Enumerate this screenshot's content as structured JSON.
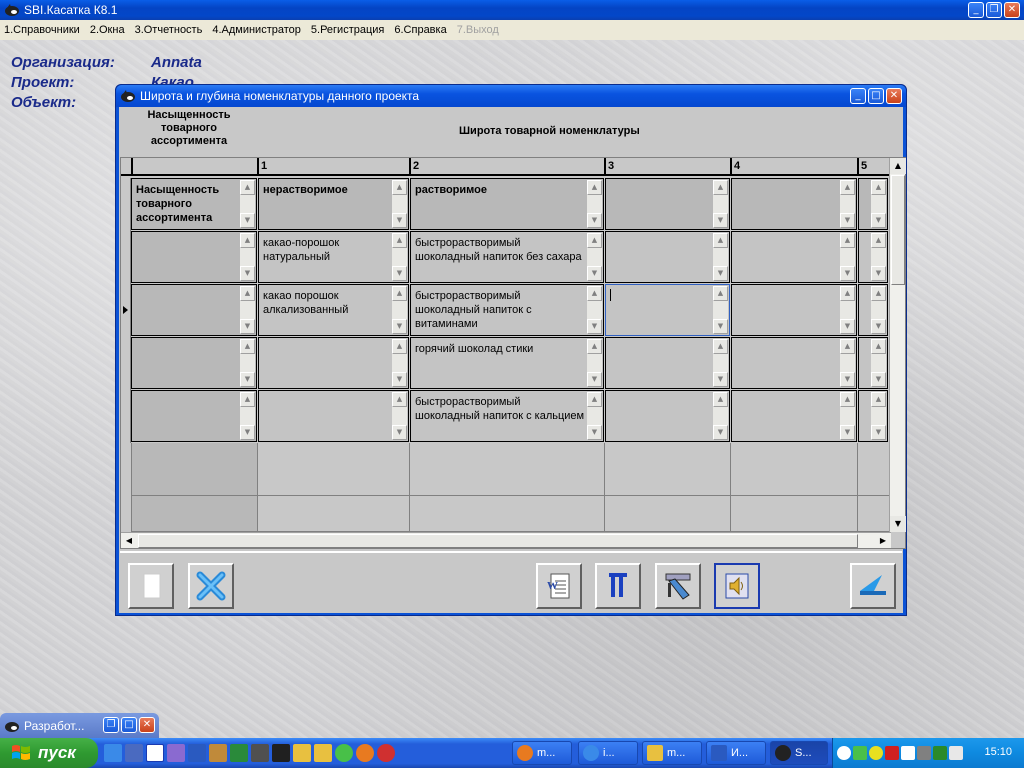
{
  "app": {
    "title": "SBI.Касатка К8.1",
    "menu": [
      {
        "label": "1.Справочники",
        "enabled": true
      },
      {
        "label": "2.Окна",
        "enabled": true
      },
      {
        "label": "3.Отчетность",
        "enabled": true
      },
      {
        "label": "4.Администратор",
        "enabled": true
      },
      {
        "label": "5.Регистрация",
        "enabled": true
      },
      {
        "label": "6.Справка",
        "enabled": true
      },
      {
        "label": "7.Выход",
        "enabled": false
      }
    ]
  },
  "info": {
    "org_label": "Организация:",
    "org_value": "Annata",
    "project_label": "Проект:",
    "project_value": "Какао",
    "object_label": "Объект:"
  },
  "dialog": {
    "title": "Широта и глубина номенклатуры данного проекта",
    "header_left": "Насыщенность товарного ассортимента",
    "header_right": "Широта товарной номенклатуры",
    "column_numbers": [
      "1",
      "2",
      "3",
      "4",
      "5"
    ],
    "rows": [
      {
        "first": "Насыщенность товарного ассортимента",
        "cells": [
          "нерастворимое",
          "растворимое",
          "",
          ""
        ],
        "is_header": true,
        "current": false
      },
      {
        "first": "",
        "cells": [
          "какао-порошок натуральный",
          "быстрорастворимый шоколадный напиток без сахара",
          "",
          ""
        ],
        "is_header": false,
        "current": false
      },
      {
        "first": "",
        "cells": [
          "какао порошок алкализованный",
          "быстрорастворимый шоколадный напиток с витаминами",
          "",
          ""
        ],
        "is_header": false,
        "current": true
      },
      {
        "first": "",
        "cells": [
          "",
          "горячий шоколад стики",
          "",
          ""
        ],
        "is_header": false,
        "current": false
      },
      {
        "first": "",
        "cells": [
          "",
          "быстрорастворимый шоколадный напиток с кальцием",
          "",
          ""
        ],
        "is_header": false,
        "current": false
      }
    ],
    "toolbar": {
      "left_buttons": [
        "new-document-icon",
        "delete-x-icon"
      ],
      "right_buttons": [
        "word-export-icon",
        "paragraph-icon",
        "film-icon",
        "speaker-icon"
      ],
      "exit_button": "back-arrow-icon"
    }
  },
  "minimized_window": {
    "title": "Разработ..."
  },
  "taskbar": {
    "start_label": "пуск",
    "quick_launch": [
      "ie-icon",
      "user-icon",
      "info-icon",
      "spider-icon",
      "word-icon",
      "db-icon",
      "excel-icon",
      "calc-icon",
      "ico-icon",
      "folder-icon",
      "folder-icon-2",
      "flower-icon",
      "firefox-icon",
      "opera-icon"
    ],
    "tasks": [
      {
        "label": "m...",
        "icon": "firefox-icon",
        "active": false
      },
      {
        "label": "i...",
        "icon": "ie-icon",
        "active": false
      },
      {
        "label": "m...",
        "icon": "folder-icon",
        "active": false
      },
      {
        "label": "И...",
        "icon": "word-icon",
        "active": false
      },
      {
        "label": "S...",
        "icon": "app-icon",
        "active": true
      }
    ],
    "clock": "15:10"
  },
  "colors": {
    "xp_blue": "#245edb",
    "start_green": "#2f9a31",
    "label_blue": "#1a2a8a"
  }
}
